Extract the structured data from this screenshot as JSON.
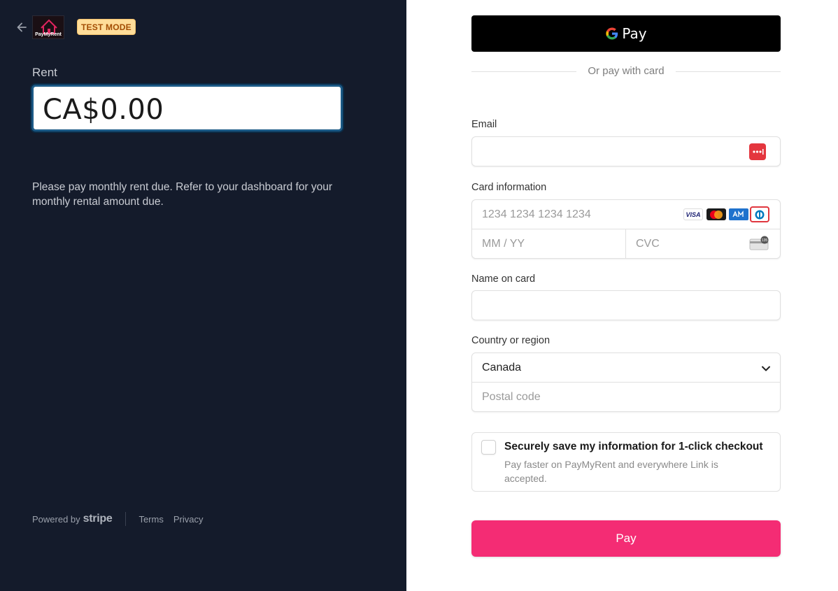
{
  "header": {
    "back_icon": "arrow-left-icon",
    "logo_text": "PayMyRent",
    "test_badge": "TEST MODE"
  },
  "product": {
    "name": "Rent",
    "amount": "CA$0.00",
    "description": "Please pay monthly rent due. Refer to your dashboard for your monthly rental amount due."
  },
  "footer": {
    "powered_by": "Powered by",
    "stripe": "stripe",
    "terms": "Terms",
    "privacy": "Privacy"
  },
  "payment": {
    "gpay_label": "Pay",
    "divider_text": "Or pay with card",
    "email_label": "Email",
    "email_value": "",
    "card_label": "Card information",
    "card_number_placeholder": "1234 1234 1234 1234",
    "expiry_placeholder": "MM / YY",
    "cvc_placeholder": "CVC",
    "card_brands": [
      "VISA",
      "mastercard-icon",
      "amex-icon",
      "diners-icon"
    ],
    "name_label": "Name on card",
    "name_value": "",
    "country_label": "Country or region",
    "country_value": "Canada",
    "postal_placeholder": "Postal code",
    "save_title": "Securely save my information for 1-click checkout",
    "save_subtitle": "Pay faster on PayMyRent and everywhere Link is accepted.",
    "pay_button": "Pay"
  },
  "colors": {
    "left_bg": "#141b2b",
    "pay_button": "#f42c74",
    "badge_bg": "#ffdd99",
    "badge_text": "#a34e05"
  }
}
